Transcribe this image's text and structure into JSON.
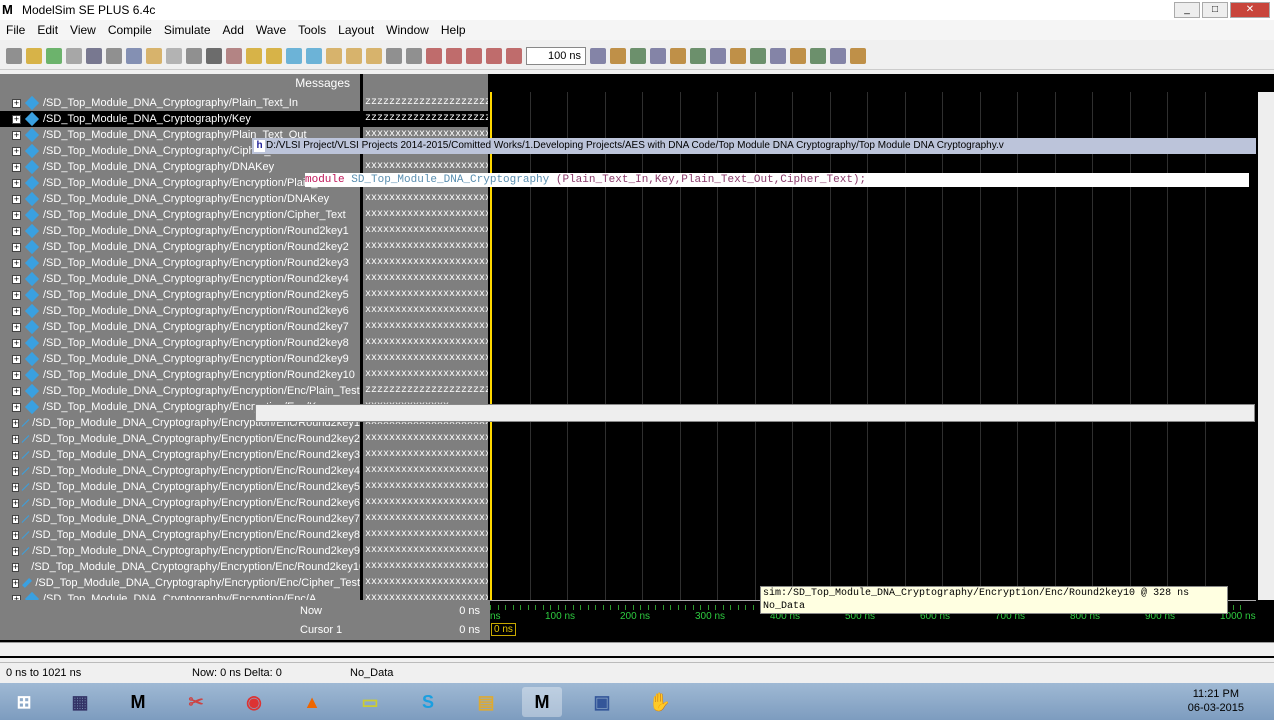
{
  "window": {
    "title": "ModelSim SE PLUS 6.4c"
  },
  "menu": [
    "File",
    "Edit",
    "View",
    "Compile",
    "Simulate",
    "Add",
    "Wave",
    "Tools",
    "Layout",
    "Window",
    "Help"
  ],
  "toolbar": {
    "time_value": "100 ns"
  },
  "wave": {
    "messages_header": "Messages",
    "signals": [
      {
        "name": "/SD_Top_Module_DNA_Cryptography/Plain_Text_In",
        "value": "zzzzzzzzzzzzzzzzzzzzzzzzzzzz"
      },
      {
        "name": "/SD_Top_Module_DNA_Cryptography/Key",
        "value": "zzzzzzzzzzzzzzzzzzzzzzzzz",
        "selected": true
      },
      {
        "name": "/SD_Top_Module_DNA_Cryptography/Plain_Text_Out",
        "value": "xxxxxxxxxxxxxxxxxxxxxxxxxxxx"
      },
      {
        "name": "/SD_Top_Module_DNA_Cryptography/Cipher_Text",
        "value": "xxxxxxxxxxxxxxxxxxxxxxxxxxxx"
      },
      {
        "name": "/SD_Top_Module_DNA_Cryptography/DNAKey",
        "value": "xxxxxxxxxxxxxxxxxxxxxxxxxxxx"
      },
      {
        "name": "/SD_Top_Module_DNA_Cryptography/Encryption/Plain_Text",
        "value": "zzzzzzzzzzzzzzzzzzzzzzzzzzzz"
      },
      {
        "name": "/SD_Top_Module_DNA_Cryptography/Encryption/DNAKey",
        "value": "xxxxxxxxxxxxxxxxxxxxxxxxxxxx"
      },
      {
        "name": "/SD_Top_Module_DNA_Cryptography/Encryption/Cipher_Text",
        "value": "xxxxxxxxxxxxxxxxxxxxxxxxxxxx"
      },
      {
        "name": "/SD_Top_Module_DNA_Cryptography/Encryption/Round2key1",
        "value": "xxxxxxxxxxxxxxxxxxxxxxxxxxxx"
      },
      {
        "name": "/SD_Top_Module_DNA_Cryptography/Encryption/Round2key2",
        "value": "xxxxxxxxxxxxxxxxxxxxxxxxxxxx"
      },
      {
        "name": "/SD_Top_Module_DNA_Cryptography/Encryption/Round2key3",
        "value": "xxxxxxxxxxxxxxxxxxxxxxxxxxxx"
      },
      {
        "name": "/SD_Top_Module_DNA_Cryptography/Encryption/Round2key4",
        "value": "xxxxxxxxxxxxxxxxxxxxxxxxxxxx"
      },
      {
        "name": "/SD_Top_Module_DNA_Cryptography/Encryption/Round2key5",
        "value": "xxxxxxxxxxxxxxxxxxxxxxxxxxxx"
      },
      {
        "name": "/SD_Top_Module_DNA_Cryptography/Encryption/Round2key6",
        "value": "xxxxxxxxxxxxxxxxxxxxxxxxxxxx"
      },
      {
        "name": "/SD_Top_Module_DNA_Cryptography/Encryption/Round2key7",
        "value": "xxxxxxxxxxxxxxxxxxxxxxxxxxxx"
      },
      {
        "name": "/SD_Top_Module_DNA_Cryptography/Encryption/Round2key8",
        "value": "xxxxxxxxxxxxxxxxxxxxxxxxxxxx"
      },
      {
        "name": "/SD_Top_Module_DNA_Cryptography/Encryption/Round2key9",
        "value": "xxxxxxxxxxxxxxxxxxxxxxxxxxxx"
      },
      {
        "name": "/SD_Top_Module_DNA_Cryptography/Encryption/Round2key10",
        "value": "xxxxxxxxxxxxxxxxxxxxxxxxxxxx"
      },
      {
        "name": "/SD_Top_Module_DNA_Cryptography/Encryption/Enc/Plain_Test",
        "value": "zzzzzzzzzzzzzzzzzzzzzzzzzzzz"
      },
      {
        "name": "/SD_Top_Module_DNA_Cryptography/Encryption/Enc/Key",
        "value": "xxxxxxxxxxxxxx"
      },
      {
        "name": "/SD_Top_Module_DNA_Cryptography/Encryption/Enc/Round2key1",
        "value": "xxxxxxxxxxxxxxxxxxxxxxxxxxxx"
      },
      {
        "name": "/SD_Top_Module_DNA_Cryptography/Encryption/Enc/Round2key2",
        "value": "xxxxxxxxxxxxxxxxxxxxxxxxxxxx"
      },
      {
        "name": "/SD_Top_Module_DNA_Cryptography/Encryption/Enc/Round2key3",
        "value": "xxxxxxxxxxxxxxxxxxxxxxxxxxxx"
      },
      {
        "name": "/SD_Top_Module_DNA_Cryptography/Encryption/Enc/Round2key4",
        "value": "xxxxxxxxxxxxxxxxxxxxxxxxxxxx"
      },
      {
        "name": "/SD_Top_Module_DNA_Cryptography/Encryption/Enc/Round2key5",
        "value": "xxxxxxxxxxxxxxxxxxxxxxxxxxxx"
      },
      {
        "name": "/SD_Top_Module_DNA_Cryptography/Encryption/Enc/Round2key6",
        "value": "xxxxxxxxxxxxxxxxxxxxxxxxxxxx"
      },
      {
        "name": "/SD_Top_Module_DNA_Cryptography/Encryption/Enc/Round2key7",
        "value": "xxxxxxxxxxxxxxxxxxxxxxxxxxxx"
      },
      {
        "name": "/SD_Top_Module_DNA_Cryptography/Encryption/Enc/Round2key8",
        "value": "xxxxxxxxxxxxxxxxxxxxxxxxxxxx"
      },
      {
        "name": "/SD_Top_Module_DNA_Cryptography/Encryption/Enc/Round2key9",
        "value": "xxxxxxxxxxxxxxxxxxxxxxxxxxxx"
      },
      {
        "name": "/SD_Top_Module_DNA_Cryptography/Encryption/Enc/Round2key10",
        "value": "xxxxxxxxxxxxxxxxxxxxxxxxxxxx"
      },
      {
        "name": "/SD_Top_Module_DNA_Cryptography/Encryption/Enc/Cipher_Test",
        "value": "xxxxxxxxxxxxxxxxxxxxxxxxxxxx"
      },
      {
        "name": "/SD_Top_Module_DNA_Cryptography/Encryption/Enc/A",
        "value": "xxxxxxxxxxxxxxxxxxxxxxxxxxxx"
      }
    ],
    "now_label": "Now",
    "now_value": "0 ns",
    "cursor_label": "Cursor 1",
    "cursor_value": "0 ns",
    "cursor_marker": "0 ns",
    "ruler_labels": [
      "ns",
      "100 ns",
      "200 ns",
      "300 ns",
      "400 ns",
      "500 ns",
      "600 ns",
      "700 ns",
      "800 ns",
      "900 ns",
      "1000 ns"
    ]
  },
  "source_popup": {
    "path": "D:/VLSI Project/VLSI Projects 2014-2015/Comitted Works/1.Developing Projects/AES with DNA Code/Top Module DNA Cryptography/Top Module DNA Cryptography.v",
    "keyword": "module",
    "module_name": "SD_Top_Module_DNA_Cryptography",
    "args": "(Plain_Text_In,Key,Plain_Text_Out,Cipher_Text);"
  },
  "tooltip": {
    "line1": "sim:/SD_Top_Module_DNA_Cryptography/Encryption/Enc/Round2key10 @ 328 ns",
    "line2": "No_Data"
  },
  "status": {
    "range": "0 ns to 1021 ns",
    "now_delta": "Now: 0 ns  Delta: 0",
    "data": "No_Data"
  },
  "taskbar": {
    "time": "11:21 PM",
    "date": "06-03-2015"
  }
}
